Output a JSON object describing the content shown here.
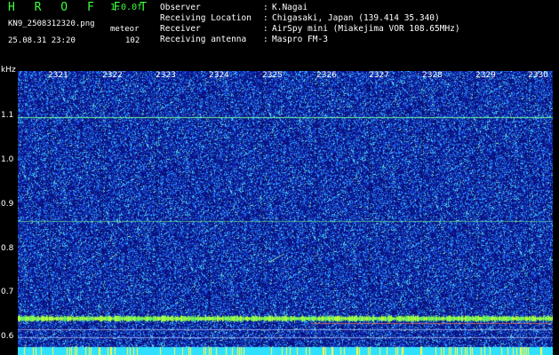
{
  "header": {
    "app_title": "H R O F F T",
    "version": "1.0.0f",
    "filename": "KN9_2508312320.png",
    "mode": "meteor",
    "timestamp": "25.08.31 23:20",
    "count": "102",
    "fields": [
      {
        "key": "Observer",
        "value": "K.Nagai"
      },
      {
        "key": "Receiving Location",
        "value": "Chigasaki, Japan (139.414 35.340)"
      },
      {
        "key": "Receiver",
        "value": "AirSpy mini (Miakejima VOR 108.65MHz)"
      },
      {
        "key": "Receiving antenna",
        "value": "Maspro FM-3"
      }
    ]
  },
  "spectrogram": {
    "y_unit": "kHz",
    "y_ticks": [
      "1.1",
      "1.0",
      "0.9",
      "0.8",
      "0.7",
      "0.6"
    ],
    "x_ticks": [
      "2321",
      "2322",
      "2323",
      "2324",
      "2325",
      "2326",
      "2327",
      "2328",
      "2329",
      "2330"
    ],
    "colors": {
      "background": "#0a0f7a",
      "noise": "#3fd3ff",
      "line": "#6cff9a",
      "band": "#b0ff40"
    }
  }
}
